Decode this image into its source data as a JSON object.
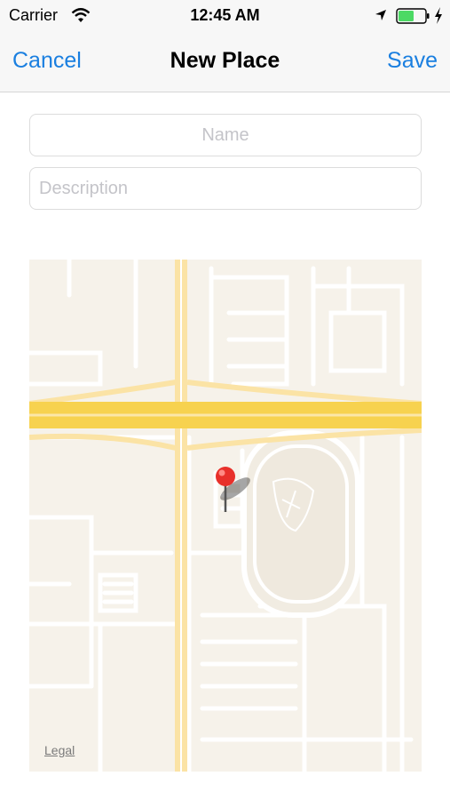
{
  "status_bar": {
    "carrier": "Carrier",
    "time": "12:45 AM",
    "icons": [
      "wifi-icon",
      "location-arrow-icon",
      "battery-icon",
      "charging-bolt-icon"
    ],
    "battery_color": "#4cd964"
  },
  "nav": {
    "cancel_label": "Cancel",
    "title": "New Place",
    "save_label": "Save",
    "accent_color": "#1a7fe0"
  },
  "form": {
    "name_placeholder": "Name",
    "name_value": "",
    "description_placeholder": "Description",
    "description_value": ""
  },
  "map": {
    "legal_label": "Legal",
    "pin_color": "#e8302a",
    "highway_color": "#f7d24f"
  }
}
